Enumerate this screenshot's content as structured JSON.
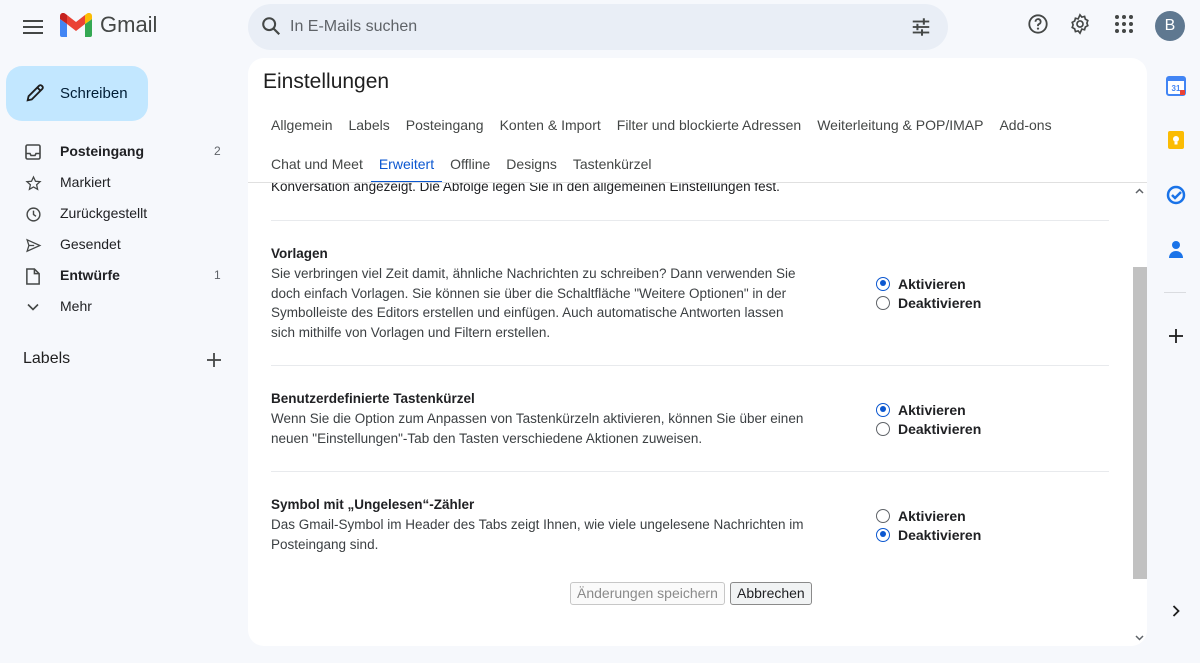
{
  "app": {
    "name": "Gmail"
  },
  "search": {
    "placeholder": "In E-Mails suchen"
  },
  "header": {
    "avatar_letter": "B"
  },
  "sidebar": {
    "compose_label": "Schreiben",
    "items": [
      {
        "label": "Posteingang",
        "count": "2",
        "icon": "inbox-icon"
      },
      {
        "label": "Markiert",
        "count": "",
        "icon": "star-icon"
      },
      {
        "label": "Zurückgestellt",
        "count": "",
        "icon": "clock-icon"
      },
      {
        "label": "Gesendet",
        "count": "",
        "icon": "send-icon"
      },
      {
        "label": "Entwürfe",
        "count": "1",
        "icon": "draft-icon"
      },
      {
        "label": "Mehr",
        "count": "",
        "icon": "chevron-down-icon"
      }
    ],
    "labels_heading": "Labels"
  },
  "settings": {
    "title": "Einstellungen",
    "tabs_row1": [
      "Allgemein",
      "Labels",
      "Posteingang",
      "Konten & Import",
      "Filter und blockierte Adressen",
      "Weiterleitung & POP/IMAP",
      "Add-ons"
    ],
    "tabs_row2": [
      "Chat und Meet",
      "Erweitert",
      "Offline",
      "Designs",
      "Tastenkürzel"
    ],
    "active_tab": "Erweitert",
    "cut_text": "Konversation angezeigt. Die Abfolge legen Sie in den allgemeinen Einstellungen fest.",
    "sections": [
      {
        "title": "Vorlagen",
        "description": "Sie verbringen viel Zeit damit, ähnliche Nachrichten zu schreiben? Dann verwenden Sie doch einfach Vorlagen. Sie können sie über die Schaltfläche \"Weitere Optionen\" in der Symbolleiste des Editors erstellen und einfügen. Auch automatische Antworten lassen sich mithilfe von Vorlagen und Filtern erstellen.",
        "option_on": "Aktivieren",
        "option_off": "Deaktivieren",
        "selected": "on"
      },
      {
        "title": "Benutzerdefinierte Tastenkürzel",
        "description": "Wenn Sie die Option zum Anpassen von Tastenkürzeln aktivieren, können Sie über einen neuen \"Einstellungen\"-Tab den Tasten verschiedene Aktionen zuweisen.",
        "option_on": "Aktivieren",
        "option_off": "Deaktivieren",
        "selected": "on"
      },
      {
        "title": "Symbol mit „Ungelesen“-Zähler",
        "description": "Das Gmail-Symbol im Header des Tabs zeigt Ihnen, wie viele ungelesene Nachrichten im Posteingang sind.",
        "option_on": "Aktivieren",
        "option_off": "Deaktivieren",
        "selected": "off"
      }
    ],
    "save_label": "Änderungen speichern",
    "cancel_label": "Abbrechen"
  },
  "colors": {
    "accent": "#0b57d0",
    "compose_bg": "#c2e7ff",
    "page_bg": "#f6f8fc",
    "search_bg": "#e9eef6"
  }
}
